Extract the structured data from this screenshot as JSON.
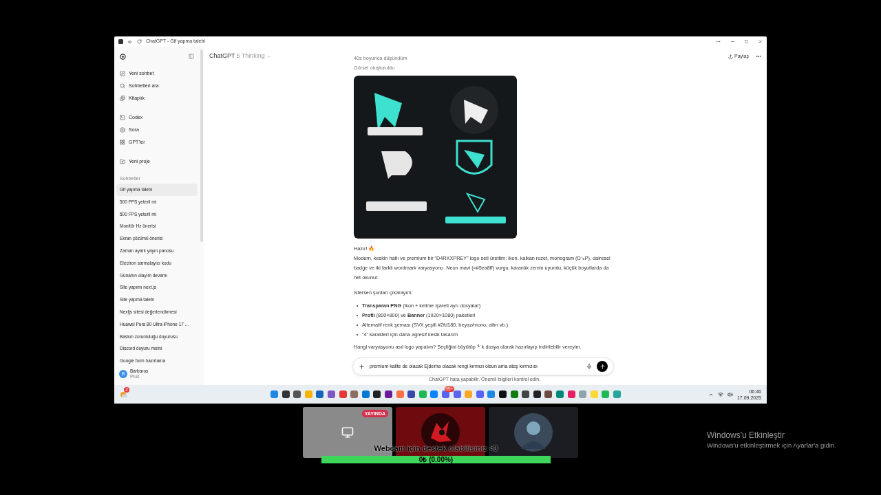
{
  "window": {
    "title": "ChatGPT - Gif yapma talebi"
  },
  "sidebar": {
    "nav": [
      {
        "label": "Yeni sohbet"
      },
      {
        "label": "Sohbetleri ara"
      },
      {
        "label": "Kitaplık"
      }
    ],
    "tools": [
      {
        "label": "Codex"
      },
      {
        "label": "Sora"
      },
      {
        "label": "GPT'ler"
      }
    ],
    "project": "Yeni proje",
    "section_label": "Sohbetler",
    "chats": [
      {
        "label": "Gif yapma talebi",
        "selected": true
      },
      {
        "label": "500 FPS yeterli mi",
        "selected": false
      },
      {
        "label": "500 FPS yeterli mi",
        "selected": false
      },
      {
        "label": "Monitör Hz önerisi",
        "selected": false
      },
      {
        "label": "Ekran çözümü önerisi",
        "selected": false
      },
      {
        "label": "Zaman ayarlı yayın panosu",
        "selected": false
      },
      {
        "label": "Electron sarmalayıcı kodu",
        "selected": false
      },
      {
        "label": "Günahın olayım devamı",
        "selected": false
      },
      {
        "label": "Site yapımı next.js",
        "selected": false
      },
      {
        "label": "Site yapma talebi",
        "selected": false
      },
      {
        "label": "Nextjs sitesi değerlendirmesi",
        "selected": false
      },
      {
        "label": "Huawei Pura 80 Ultra iPhone 17 ...",
        "selected": false
      },
      {
        "label": "Baskın zorunluluğu duyurusu",
        "selected": false
      },
      {
        "label": "Discord duyuru metni",
        "selected": false
      },
      {
        "label": "Google form hazırlama",
        "selected": false
      }
    ],
    "user": {
      "initial": "B",
      "name": "Barbaros",
      "plan": "Plus"
    }
  },
  "header": {
    "model": "ChatGPT",
    "variant": "5 Thinking",
    "share": "Paylaş"
  },
  "message": {
    "thinking": "40s boyunca düşündüm",
    "image_status": "Görsel oluşturuldu",
    "heading": "Hazır! 🔥",
    "paragraph": "Modern, keskin hatlı ve premium bir “D4RKXPREY” logo seti ürettim: ikon, kalkan rozet, monogram (D↘P), dairesel badge ve iki farklı wordmark varyasyonu. Neon mavi (≈#5ea8ff) vurgu, karanlık zemin uyumlu; küçük boyutlarda da net okunur.",
    "intro": "İstersen şunları çıkarayım:",
    "bullets": [
      "**Transparan PNG** (ikon + kelime işareti ayrı dosyalar)",
      "**Profil** (800×800) ve **Banner** (1920×1080) paketleri",
      "Alternatif renk şeması (SVX yeşili #2fd180, beyaz/mono, altın vb.)",
      "“4” karakteri için daha agresif kesik tasarım"
    ],
    "question_before": "Hangi varyasyonu asıl logo yapalım? Seçtiğini büyütüp",
    "question_after": "k dosya olarak hazırlayıp indirilebilir vereyim."
  },
  "composer": {
    "value": "premium kalite de olacak Ejderha olacak rengi kırmızı olsun ama ateş kırmızısı",
    "disclaimer": "ChatGPT hata yapabilir. Önemli bilgileri kontrol edin."
  },
  "taskbar": {
    "weather_badge": "2",
    "chat_badge": "99+",
    "time": "06:46",
    "date": "17.09.2025"
  },
  "stream": {
    "tiles": [
      {
        "kind": "screen",
        "badge": "YAYINDA"
      },
      {
        "kind": "logo"
      },
      {
        "kind": "person"
      }
    ],
    "goal": {
      "title": "Webcam için destek olabilisiniz <3",
      "amount": "0₺ (0.00%)"
    }
  },
  "activation": {
    "title": "Windows'u Etkinleştir",
    "subtitle": "Windows'u etkinleştirmek için Ayarlar'a gidin."
  }
}
